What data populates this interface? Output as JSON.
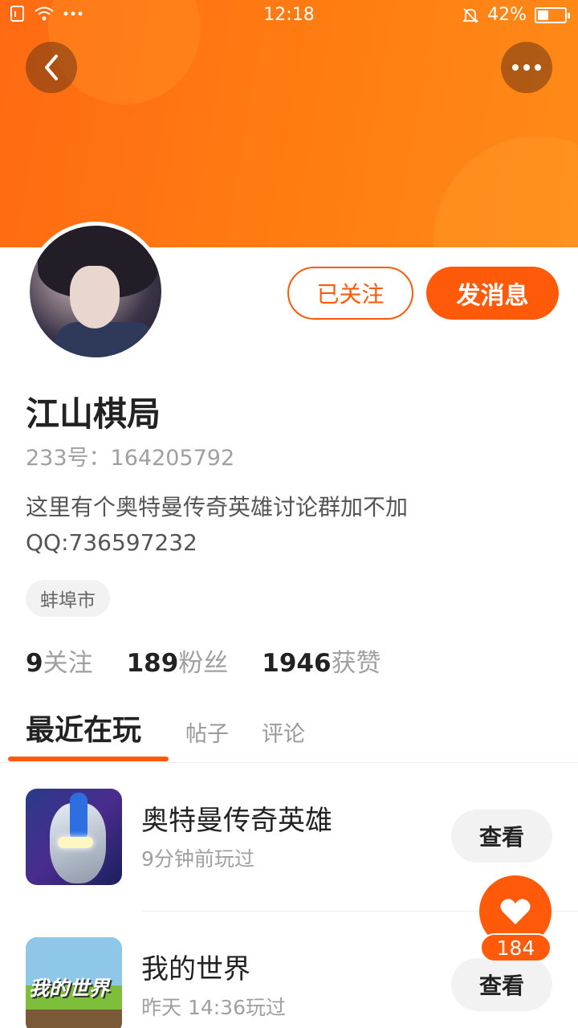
{
  "statusbar": {
    "time": "12:18",
    "battery": "42%",
    "battery_level": 0.42
  },
  "profile": {
    "name": "江山棋局",
    "uid_label": "233号：164205792",
    "bio_line1": "这里有个奥特曼传奇英雄讨论群加不加",
    "bio_line2": "QQ:736597232",
    "location": "蚌埠市",
    "follow_status": "已关注",
    "message_button": "发消息"
  },
  "stats": [
    {
      "num": "9",
      "label": "关注"
    },
    {
      "num": "189",
      "label": "粉丝"
    },
    {
      "num": "1946",
      "label": "获赞"
    }
  ],
  "tabs": [
    "最近在玩",
    "帖子",
    "评论"
  ],
  "games": [
    {
      "name": "奥特曼传奇英雄",
      "time": "9分钟前玩过",
      "button": "查看",
      "icon": "ultraman-game-icon"
    },
    {
      "name": "我的世界",
      "time": "昨天 14:36玩过",
      "button": "查看",
      "icon": "minecraft-game-icon",
      "logo_text": "我的世界"
    }
  ],
  "like_fab": {
    "count": "184"
  },
  "colors": {
    "accent": "#ff5a0a",
    "hero": "#ff7a12"
  }
}
